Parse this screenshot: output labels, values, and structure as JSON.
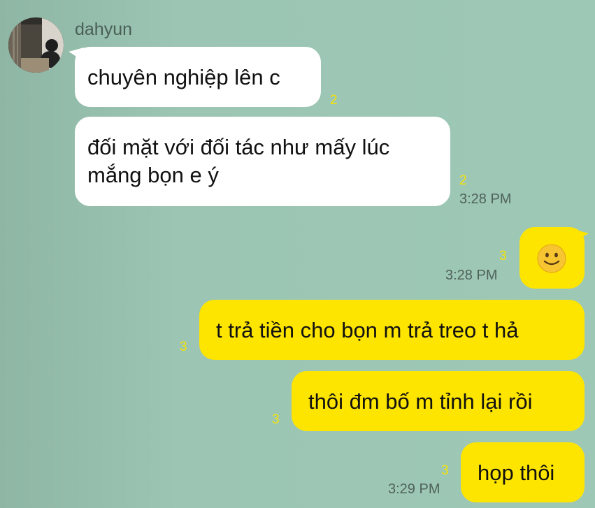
{
  "chat": {
    "sender_name": "dahyun",
    "messages": [
      {
        "direction": "in",
        "text": "chuyên nghiệp lên c",
        "unread": "2",
        "time": ""
      },
      {
        "direction": "in",
        "text_lines": [
          "đối mặt với đối tác như mấy lúc",
          "mắng bọn e ý"
        ],
        "unread": "2",
        "time": "3:28 PM"
      },
      {
        "direction": "out",
        "text": "🙂",
        "unread": "3",
        "time": "3:28 PM"
      },
      {
        "direction": "out",
        "text": "t trả tiền cho bọn m trả treo t hả",
        "unread": "3",
        "time": ""
      },
      {
        "direction": "out",
        "text": "thôi đm bố m tỉnh lại rồi",
        "unread": "3",
        "time": ""
      },
      {
        "direction": "out",
        "text": "họp thôi",
        "unread": "3",
        "time": "3:29 PM"
      }
    ]
  },
  "colors": {
    "incoming_bubble": "#ffffff",
    "outgoing_bubble": "#fee500",
    "unread_count": "#f4e20a"
  }
}
